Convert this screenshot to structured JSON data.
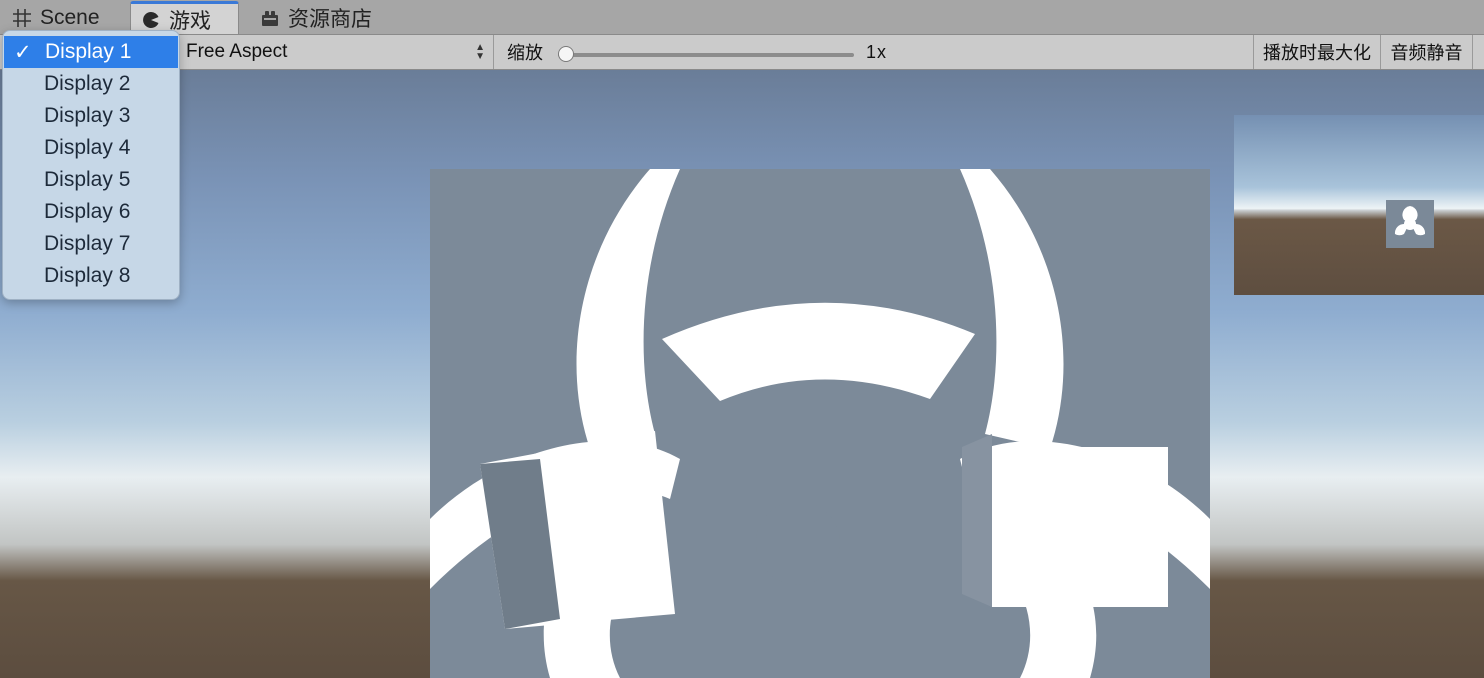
{
  "tabs": [
    {
      "label": "Scene",
      "icon": "grid-icon"
    },
    {
      "label": "游戏",
      "icon": "pacman-icon",
      "active": true
    },
    {
      "label": "资源商店",
      "icon": "store-icon"
    }
  ],
  "toolbar": {
    "aspect": "Free Aspect",
    "zoom_label": "缩放",
    "zoom_value": "1x",
    "zoom_level": 0.0,
    "maximize_on_play": "播放时最大化",
    "mute_audio": "音频静音"
  },
  "display_menu": {
    "selected": "Display 1",
    "check": "✓",
    "items": [
      "Display 1",
      "Display 2",
      "Display 3",
      "Display 4",
      "Display 5",
      "Display 6",
      "Display 7",
      "Display 8"
    ]
  },
  "colors": {
    "accent": "#2e7fe8",
    "sky_top": "#6a7d98",
    "ground": "#5c4d3f",
    "panel": "#7c8a99"
  }
}
